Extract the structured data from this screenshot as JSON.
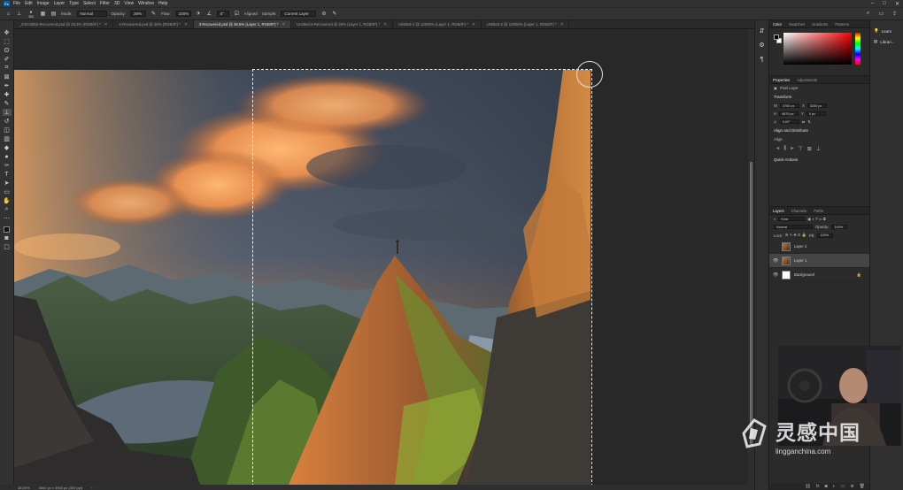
{
  "menubar": {
    "logo": "Ps",
    "items": [
      "File",
      "Edit",
      "Image",
      "Layer",
      "Type",
      "Select",
      "Filter",
      "3D",
      "View",
      "Window",
      "Help"
    ]
  },
  "options": {
    "brush_size": "360",
    "mode_label": "Mode:",
    "mode_value": "Normal",
    "opacity_label": "Opacity:",
    "opacity_value": "26%",
    "flow_label": "Flow:",
    "flow_value": "100%",
    "angle_value": "0°",
    "aligned_label": "Aligned",
    "sample_label": "Sample:",
    "sample_value": "Current Layer"
  },
  "tabs": [
    {
      "label": "_DSC6862-Recovered.psd @ 33,3% (RGB/8*) *",
      "active": false
    },
    {
      "label": "4-Recovered.psd @ 25% (RGB/8*) *",
      "active": false
    },
    {
      "label": "3-Recovered.psd @ 38,6% (Layer 1, RGB/8*) *",
      "active": true
    },
    {
      "label": "Untitled-3-Recovered @ 25% (Layer 1, RGB/8*) *",
      "active": false
    },
    {
      "label": "Untitled-1 @ 12000% (Layer 1, RGB/8*) *",
      "active": false
    },
    {
      "label": "Untitled-2 @ 12000% (Layer 1, RGB/8*) *",
      "active": false
    }
  ],
  "status": {
    "zoom": "38,59%",
    "doc_size": "3800 px x 3950 px (300 ppi)"
  },
  "color_panel": {
    "tabs": [
      "Color",
      "Swatches",
      "Gradients",
      "Patterns"
    ]
  },
  "properties": {
    "tabs": [
      "Properties",
      "Adjustments"
    ],
    "kind": "Pixel Layer",
    "transform_title": "Transform",
    "w_label": "W",
    "w_value": "3750 px",
    "x_label": "X",
    "x_value": "3200 px",
    "h_label": "H",
    "h_value": "4875 px",
    "y_label": "Y",
    "y_value": "0 px",
    "angle_value": "0,00°",
    "align_title": "Align and Distribute",
    "align_label": "Align:",
    "quick_actions": "Quick Actions"
  },
  "layers_panel": {
    "tabs": [
      "Layers",
      "Channels",
      "Paths"
    ],
    "filter_kind": "Kind",
    "blend_mode": "Normal",
    "opacity_label": "Opacity:",
    "opacity_value": "100%",
    "lock_label": "Lock:",
    "fill_label": "Fill:",
    "fill_value": "100%",
    "layers": [
      {
        "name": "Layer 2",
        "visible": false,
        "selected": false,
        "thumb": "photo"
      },
      {
        "name": "Layer 1",
        "visible": true,
        "selected": true,
        "thumb": "photo"
      },
      {
        "name": "Background",
        "visible": true,
        "selected": false,
        "thumb": "white"
      }
    ]
  },
  "learn": {
    "items": [
      "Learn",
      "Librari..."
    ]
  },
  "watermark": {
    "cn": "灵感中国",
    "en": "lingganchina.com"
  },
  "colors": {
    "accent": "#1473e6",
    "panel": "#2b2b2b"
  }
}
